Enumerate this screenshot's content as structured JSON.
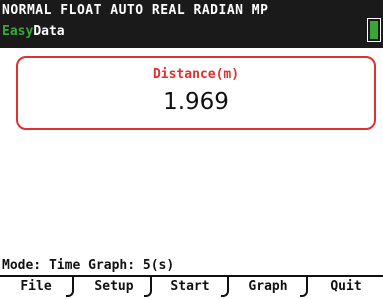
{
  "status": {
    "mode_line": "NORMAL FLOAT AUTO REAL RADIAN MP",
    "app_prefix": "Easy",
    "app_name": "Data",
    "battery_icon": "battery-icon",
    "accent_color": "#3aa63a"
  },
  "reading": {
    "label": "Distance(m)",
    "value": "1.969",
    "label_color": "#e03030"
  },
  "mode": {
    "text": "Mode: Time Graph: 5(s)"
  },
  "softkeys": [
    {
      "label": "File"
    },
    {
      "label": "Setup"
    },
    {
      "label": "Start"
    },
    {
      "label": "Graph"
    },
    {
      "label": "Quit"
    }
  ]
}
